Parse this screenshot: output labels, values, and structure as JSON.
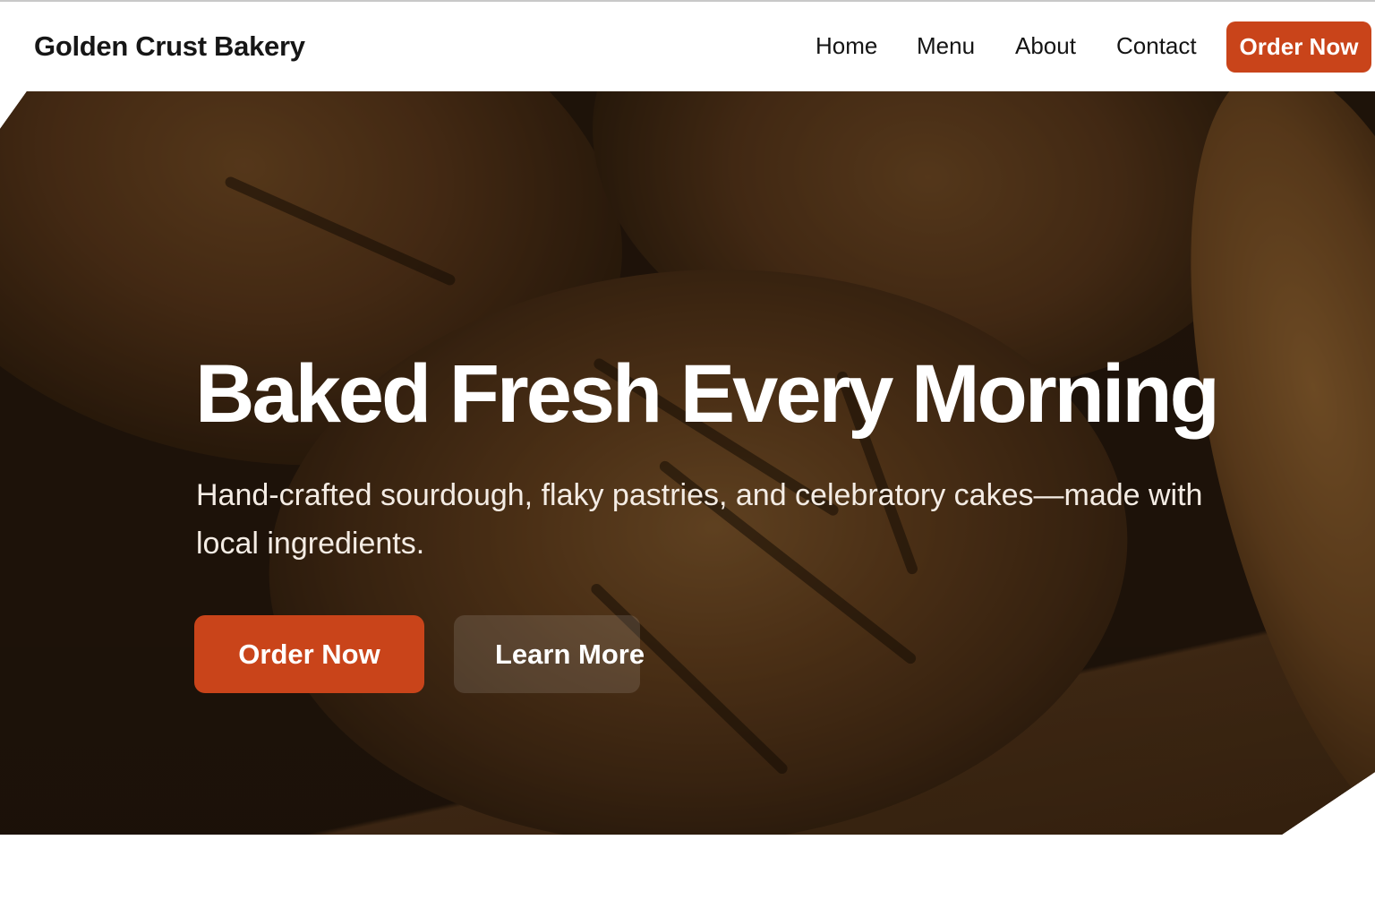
{
  "header": {
    "brand": "Golden Crust Bakery",
    "nav": [
      "Home",
      "Menu",
      "About",
      "Contact"
    ],
    "cta_label": "Order Now"
  },
  "hero": {
    "background_image": "rustic sourdough bread loaves on wooden table",
    "headline": "Baked Fresh Every Morning",
    "subtext": "Hand-crafted sourdough, flaky pastries, and celebratory cakes—made with local ingredients.",
    "primary_button": "Order Now",
    "secondary_button": "Learn More"
  },
  "colors": {
    "accent": "#c9441a",
    "text_dark": "#141414",
    "text_light": "#ffffff"
  }
}
